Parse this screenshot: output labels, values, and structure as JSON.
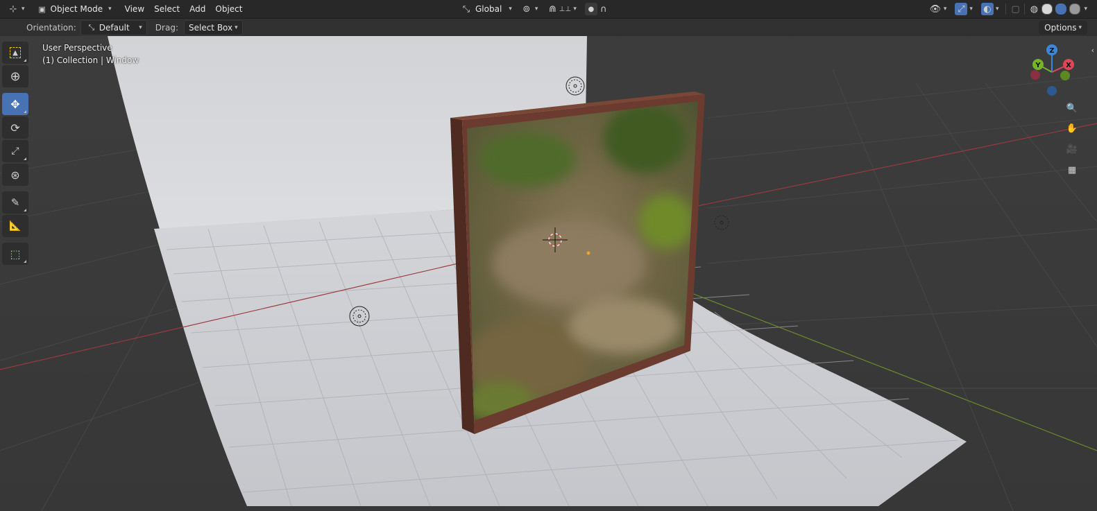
{
  "header": {
    "editor_type_icon": "viewport-editor-icon",
    "mode": "Object Mode",
    "menus": [
      "View",
      "Select",
      "Add",
      "Object"
    ],
    "transform_orientation": "Global",
    "pivot_icon": "pivot-icon",
    "snap_icon": "snap-icon",
    "proportional_icon": "proportional-edit-icon"
  },
  "tool_settings": {
    "orientation_label": "Orientation:",
    "orientation_value": "Default",
    "drag_label": "Drag:",
    "drag_value": "Select Box",
    "options_label": "Options"
  },
  "viewport": {
    "view_name": "User Perspective",
    "collection_info": "(1) Collection | Window"
  },
  "gizmo": {
    "z_label": "Z",
    "y_label": "Y",
    "x_label": "X",
    "colors": {
      "x": "#e04558",
      "y": "#78b428",
      "z": "#3d88d6"
    }
  },
  "toolbar": {
    "tools": [
      "select-box-tool",
      "cursor-tool",
      "move-tool",
      "rotate-tool",
      "scale-tool",
      "transform-tool",
      "annotate-tool",
      "measure-tool",
      "add-cube-tool"
    ],
    "active": "move-tool"
  },
  "colors": {
    "header_bg": "#282828",
    "viewport_bg": "#393939",
    "accent": "#4772b3",
    "backdrop": "#d5d6d9",
    "frame": "#6a3b2e"
  }
}
